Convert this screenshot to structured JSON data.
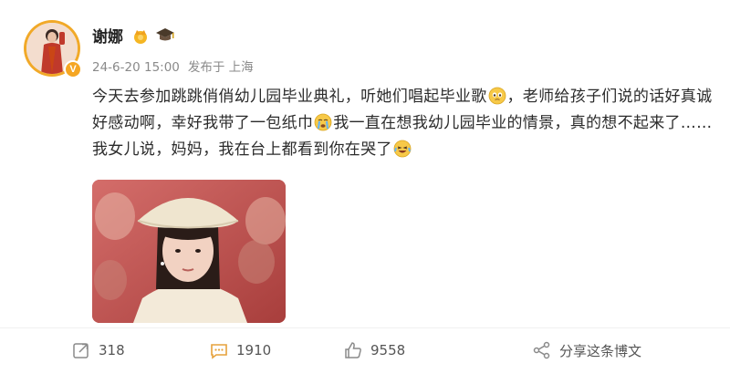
{
  "user": {
    "name": "谢娜",
    "verified_badge": "V",
    "badges": [
      "crown-icon",
      "graduation-cap-icon"
    ]
  },
  "meta": {
    "time": "24-6-20 15:00",
    "source": "发布于 上海"
  },
  "post": {
    "seg1": "今天去参加跳跳俏俏幼儿园毕业典礼，听她们唱起毕业歌",
    "emoji1": "moved-emoji",
    "seg2": "，老师给孩子们说的话好真诚好感动啊，幸好我带了一包纸巾",
    "emoji2": "crying-emoji",
    "seg3": "我一直在想我幼儿园毕业的情景，真的想不起来了……我女儿说，妈妈，我在台上都看到你在哭了",
    "emoji3": "laugh-cry-emoji"
  },
  "actions": {
    "share_count": "318",
    "comment_count": "1910",
    "like_count": "9558",
    "forward_label": "分享这条博文"
  },
  "colors": {
    "accent": "#f5a623",
    "text": "#2b2b2b",
    "meta": "#8a8a8a"
  }
}
